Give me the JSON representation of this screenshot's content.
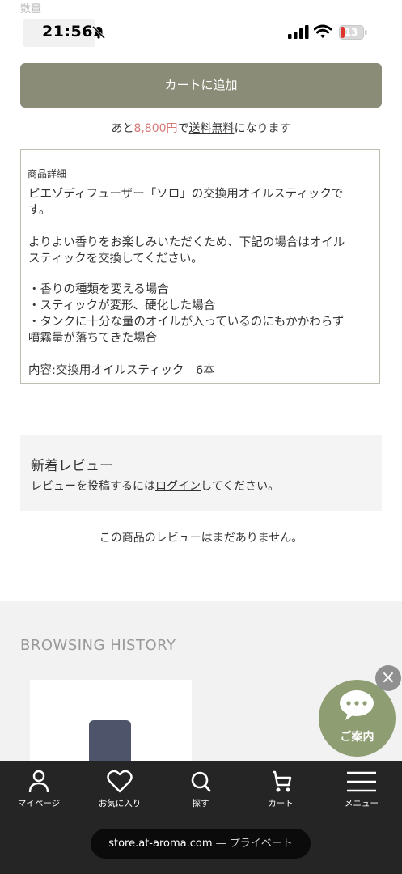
{
  "status_bar": {
    "ghost_label": "数量",
    "time": "21:56",
    "battery": "13"
  },
  "cart": {
    "add_button": "カートに追加",
    "shipping_prefix": "あと",
    "shipping_amount": "8,800円",
    "shipping_mid": "で",
    "shipping_link": "送料無料",
    "shipping_suffix": "になります"
  },
  "detail": {
    "title": "商品詳細",
    "lines": [
      "ピエゾディフューザー「ソロ」の交換用オイルスティックで",
      "す。",
      "よりよい香りをお楽しみいただくため、下記の場合はオイル",
      "スティックを交換してください。",
      "・香りの種類を変える場合",
      "・スティックが変形、硬化した場合",
      "・タンクに十分な量のオイルが入っているのにもかかわらず",
      "噴霧量が落ちてきた場合",
      "内容:交換用オイルスティック　6本"
    ]
  },
  "reviews": {
    "title": "新着レビュー",
    "sub_prefix": "レビューを投稿するには",
    "login_link": "ログイン",
    "sub_suffix": "してください。",
    "empty": "この商品のレビューはまだありません。"
  },
  "history": {
    "title": "BROWSING HISTORY"
  },
  "chat": {
    "close": "×",
    "label": "ご案内"
  },
  "tabs": [
    {
      "label": "マイページ",
      "icon": "person-icon"
    },
    {
      "label": "お気に入り",
      "icon": "heart-icon"
    },
    {
      "label": "探す",
      "icon": "search-icon"
    },
    {
      "label": "カート",
      "icon": "cart-icon"
    },
    {
      "label": "メニュー",
      "icon": "menu-icon"
    }
  ],
  "browser": {
    "domain": "store.at-aroma.com",
    "separator": " — ",
    "mode": "プライベート"
  },
  "colors": {
    "add_button": "#8a8c78",
    "price_accent": "#d77a7a",
    "chat_bubble": "#8e9d72",
    "tabbar": "#252525"
  }
}
